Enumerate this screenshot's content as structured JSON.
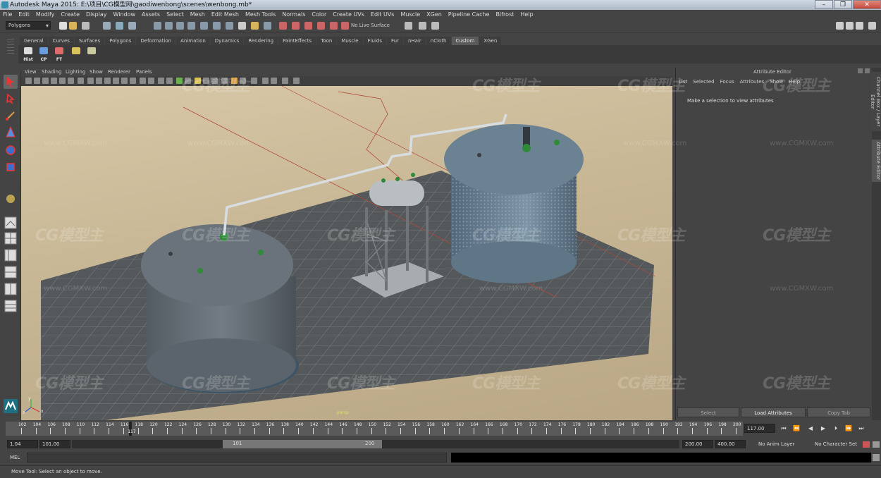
{
  "window": {
    "title": "Autodesk Maya 2015: E:\\项目\\CG模型网\\gaodiwenbong\\scenes\\wenbong.mb*",
    "controls": [
      "–",
      "❐",
      "✕"
    ]
  },
  "menubar": [
    "File",
    "Edit",
    "Modify",
    "Create",
    "Display",
    "Window",
    "Assets",
    "Select",
    "Mesh",
    "Edit Mesh",
    "Mesh Tools",
    "Normals",
    "Color",
    "Create UVs",
    "Edit UVs",
    "Muscle",
    "XGen",
    "Pipeline Cache",
    "Bifrost",
    "Help"
  ],
  "statusline": {
    "mode": "Polygons",
    "live_surface": "No Live Surface"
  },
  "shelf": {
    "tabs": [
      "General",
      "Curves",
      "Surfaces",
      "Polygons",
      "Deformation",
      "Animation",
      "Dynamics",
      "Rendering",
      "PaintEffects",
      "Toon",
      "Muscle",
      "Fluids",
      "Fur",
      "nHair",
      "nCloth",
      "Custom",
      "XGen"
    ],
    "active_tab": "Custom",
    "buttons": [
      "Hist",
      "CP",
      "FT",
      "",
      ""
    ]
  },
  "viewport": {
    "menu": [
      "View",
      "Shading",
      "Lighting",
      "Show",
      "Renderer",
      "Panels"
    ],
    "axis_labels": [
      "x",
      "y",
      "z"
    ],
    "camera_label": "persp"
  },
  "attribute_editor": {
    "title": "Attribute Editor",
    "menu": [
      "List",
      "Selected",
      "Focus",
      "Attributes",
      "Show",
      "Help"
    ],
    "message": "Make a selection to view attributes",
    "buttons": [
      "Select",
      "Load Attributes",
      "Copy Tab"
    ],
    "side_tabs": [
      "Channel Box / Layer Editor",
      "Attribute Editor"
    ]
  },
  "timeslider": {
    "tick_labels": [
      "102",
      "104",
      "106",
      "108",
      "110",
      "112",
      "114",
      "116",
      "118",
      "120",
      "122",
      "124",
      "126",
      "128",
      "130",
      "132",
      "134",
      "136",
      "138",
      "140",
      "142",
      "144",
      "146",
      "148",
      "150",
      "152",
      "154",
      "156",
      "158",
      "160",
      "162",
      "164",
      "166",
      "168",
      "170",
      "172",
      "174",
      "176",
      "178",
      "180",
      "182",
      "184",
      "186",
      "188",
      "190",
      "192",
      "194",
      "196",
      "198",
      "200"
    ],
    "current_frame_marker": "117",
    "current_frame": "117.00",
    "playback_buttons": [
      "⏮",
      "⏪",
      "◀",
      "▶",
      "⏵",
      "⏩",
      "⏭"
    ]
  },
  "range": {
    "start_time": "1.04",
    "playback_start": "101.00",
    "range_start_label": "101",
    "range_end_label": "200",
    "playback_end": "200.00",
    "end_time": "400.00",
    "anim_layer": "No Anim Layer",
    "character_set": "No Character Set"
  },
  "command_line": {
    "language": "MEL"
  },
  "help_line": "Move Tool: Select an object to move.",
  "watermarks": {
    "logo": "CG模型主",
    "url": "www.CGMXW.com"
  }
}
